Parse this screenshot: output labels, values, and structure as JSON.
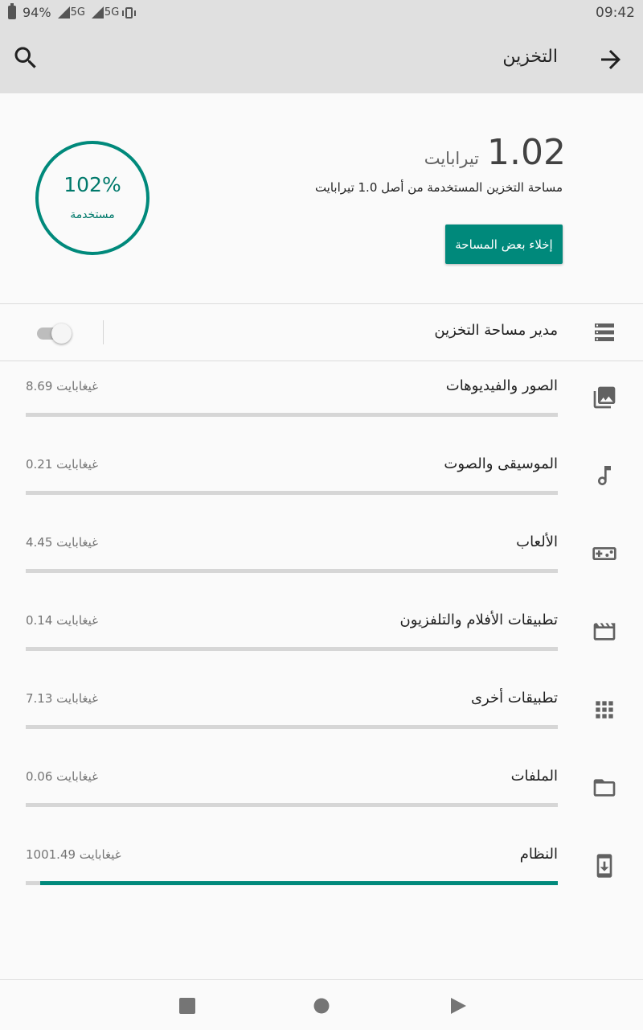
{
  "status_bar": {
    "battery": "94%",
    "network1": "5G",
    "network2": "5G",
    "time": "09:42"
  },
  "app_bar": {
    "title": "التخزين",
    "back_icon": "arrow-forward-icon",
    "search_icon": "search-icon"
  },
  "summary": {
    "percent_used": "102%",
    "percent_label": "مستخدمة",
    "total_value": "1.02",
    "total_unit": "تيرابايت",
    "used_description": "مساحة التخزين المستخدمة من أصل 1.0 تيرابايت",
    "free_button": "إخلاء بعض المساحة",
    "accent_color": "#00897b"
  },
  "storage_manager": {
    "label": "مدير مساحة التخزين",
    "enabled": false,
    "icon": "storage-icon"
  },
  "categories": [
    {
      "label": "الصور والفيديوهات",
      "size": "8.69 غيغابايت",
      "icon": "photo-icon",
      "fraction": 0
    },
    {
      "label": "الموسيقى والصوت",
      "size": "0.21 غيغابايت",
      "icon": "music-icon",
      "fraction": 0
    },
    {
      "label": "الألعاب",
      "size": "4.45 غيغابايت",
      "icon": "gamepad-icon",
      "fraction": 0
    },
    {
      "label": "تطبيقات الأفلام والتلفزيون",
      "size": "0.14 غيغابايت",
      "icon": "movie-icon",
      "fraction": 0
    },
    {
      "label": "تطبيقات أخرى",
      "size": "7.13 غيغابايت",
      "icon": "apps-icon",
      "fraction": 0
    },
    {
      "label": "الملفات",
      "size": "0.06 غيغابايت",
      "icon": "folder-icon",
      "fraction": 0
    },
    {
      "label": "النظام",
      "size": "1001.49 غيغابايت",
      "icon": "system-update-icon",
      "fraction": 0.973
    }
  ],
  "nav_bar": {
    "recents_icon": "recents-square-icon",
    "home_icon": "home-circle-icon",
    "back_icon": "back-triangle-icon"
  }
}
